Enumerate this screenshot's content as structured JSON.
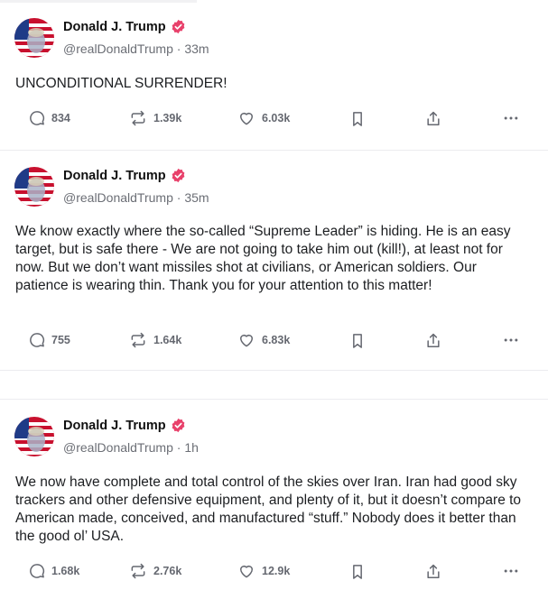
{
  "posts": [
    {
      "author": "Donald J. Trump",
      "handle": "@realDonaldTrump",
      "time": "33m",
      "text": "UNCONDITIONAL SURRENDER!",
      "replies": "834",
      "retruths": "1.39k",
      "likes": "6.03k"
    },
    {
      "author": "Donald J. Trump",
      "handle": "@realDonaldTrump",
      "time": "35m",
      "text": "We know exactly where the so-called “Supreme Leader” is hiding. He is an easy target, but is safe there - We are not going to take him out (kill!), at least not for now. But we don’t want missiles shot at civilians, or American soldiers. Our patience is wearing thin. Thank you for your attention to this matter!",
      "replies": "755",
      "retruths": "1.64k",
      "likes": "6.83k"
    },
    {
      "author": "Donald J. Trump",
      "handle": "@realDonaldTrump",
      "time": "1h",
      "text": "We now have complete and total control of the skies over Iran. Iran had good sky trackers and other defensive equipment, and plenty of it, but it doesn’t compare to American made, conceived, and manufactured “stuff.” Nobody does it better than the good ol’ USA.",
      "replies": "1.68k",
      "retruths": "2.76k",
      "likes": "12.9k"
    }
  ],
  "separator": "·",
  "icons": {
    "verified": "verified-badge-icon",
    "reply": "reply-icon",
    "retruth": "retruth-icon",
    "like": "heart-icon",
    "save": "bookmark-icon",
    "share": "share-icon",
    "more": "more-icon"
  },
  "colors": {
    "verified": "#e8416b",
    "icon": "#656870",
    "text": "#1c1e21",
    "muted": "#6b6e75"
  }
}
